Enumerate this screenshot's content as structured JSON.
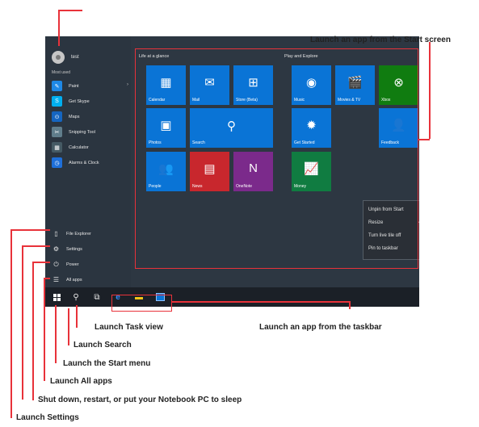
{
  "start_menu": {
    "user_name": "test",
    "most_used_label": "Most used",
    "most_used": [
      {
        "label": "Paint",
        "icon": "paint-icon",
        "color": "#1e88e5",
        "glyph": "✎",
        "has_arrow": true
      },
      {
        "label": "Get Skype",
        "icon": "skype-icon",
        "color": "#00aff0",
        "glyph": "S",
        "has_arrow": false
      },
      {
        "label": "Maps",
        "icon": "maps-icon",
        "color": "#1565c0",
        "glyph": "⊙",
        "has_arrow": false
      },
      {
        "label": "Snipping Tool",
        "icon": "snipping-tool-icon",
        "color": "#607d8b",
        "glyph": "✂",
        "has_arrow": false
      },
      {
        "label": "Calculator",
        "icon": "calculator-icon",
        "color": "#455a64",
        "glyph": "▦",
        "has_arrow": false
      },
      {
        "label": "Alarms & Clock",
        "icon": "alarm-clock-icon",
        "color": "#1e6fd9",
        "glyph": "◷",
        "has_arrow": false
      }
    ],
    "system": [
      {
        "label": "File Explorer",
        "icon": "file-explorer-icon",
        "glyph": "▯"
      },
      {
        "label": "Settings",
        "icon": "settings-gear-icon",
        "glyph": "⚙"
      },
      {
        "label": "Power",
        "icon": "power-icon",
        "glyph": "⏻"
      },
      {
        "label": "All apps",
        "icon": "all-apps-icon",
        "glyph": "☰"
      }
    ],
    "groups": {
      "life": "Life at a glance",
      "play": "Play and Explore"
    },
    "tiles": [
      {
        "label": "Calendar",
        "icon": "calendar-icon",
        "glyph": "▦",
        "color": "#0a74d6"
      },
      {
        "label": "Mail",
        "icon": "mail-icon",
        "glyph": "✉",
        "color": "#0a74d6"
      },
      {
        "label": "Store (Beta)",
        "icon": "store-icon",
        "glyph": "⊞",
        "color": "#0a74d6"
      },
      {
        "label": "Music",
        "icon": "music-icon",
        "glyph": "◉",
        "color": "#0a74d6"
      },
      {
        "label": "Movies & TV",
        "icon": "movies-icon",
        "glyph": "🎬",
        "color": "#0a74d6"
      },
      {
        "label": "Xbox",
        "icon": "xbox-icon",
        "glyph": "⊗",
        "color": "#107c10"
      },
      {
        "label": "Photos",
        "icon": "photos-icon",
        "glyph": "▣",
        "color": "#0a74d6"
      },
      {
        "label": "Search",
        "icon": "search-icon",
        "glyph": "⚲",
        "color": "#0a74d6"
      },
      {
        "label": "Get Started",
        "icon": "lightbulb-icon",
        "glyph": "✹",
        "color": "#0a74d6"
      },
      {
        "label": "Feedback",
        "icon": "feedback-icon",
        "glyph": "👤",
        "color": "#0a74d6"
      },
      {
        "label": "People",
        "icon": "people-icon",
        "glyph": "👥",
        "color": "#0a74d6"
      },
      {
        "label": "News",
        "icon": "news-icon",
        "glyph": "▤",
        "color": "#c8272d"
      },
      {
        "label": "OneNote",
        "icon": "onenote-icon",
        "glyph": "N",
        "color": "#7b2a8b"
      },
      {
        "label": "Money",
        "icon": "money-icon",
        "glyph": "📈",
        "color": "#107c41"
      }
    ],
    "context_menu": [
      "Unpin from Start",
      "Resize",
      "Turn live tile off",
      "Pin to taskbar"
    ]
  },
  "callouts": {
    "launch_from_start": "Launch an app from the Start screen",
    "task_view": "Launch Task view",
    "taskbar_app": "Launch an app from the taskbar",
    "search": "Launch Search",
    "start_menu": "Launch the Start menu",
    "all_apps": "Launch All apps",
    "shutdown": "Shut down, restart, or put your Notebook PC to sleep",
    "settings": "Launch Settings"
  },
  "colors": {
    "callout_red": "#e8323a",
    "tile_blue": "#0a74d6",
    "edge_blue": "#1e90ff"
  }
}
